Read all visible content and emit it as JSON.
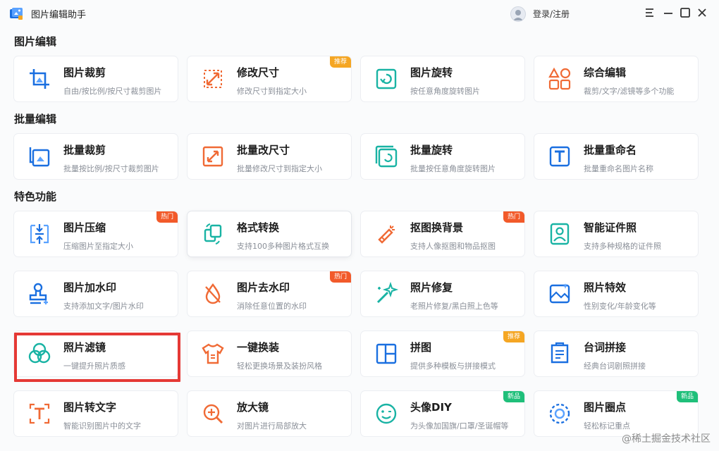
{
  "app": {
    "title": "图片编辑助手",
    "login": "登录/注册"
  },
  "sections": [
    {
      "title": "图片编辑",
      "cards": [
        {
          "title": "图片裁剪",
          "desc": "自由/按比例/按尺寸裁剪图片",
          "icon": "crop-icon"
        },
        {
          "title": "修改尺寸",
          "desc": "修改尺寸到指定大小",
          "icon": "resize-icon",
          "badge": "推荐"
        },
        {
          "title": "图片旋转",
          "desc": "按任意角度旋转图片",
          "icon": "rotate-icon"
        },
        {
          "title": "综合编辑",
          "desc": "裁剪/文字/滤镜等多个功能",
          "icon": "shapes-icon"
        }
      ]
    },
    {
      "title": "批量编辑",
      "cards": [
        {
          "title": "批量裁剪",
          "desc": "批量按比例/按尺寸裁剪图片",
          "icon": "batch-crop-icon"
        },
        {
          "title": "批量改尺寸",
          "desc": "批量修改尺寸到指定大小",
          "icon": "batch-resize-icon"
        },
        {
          "title": "批量旋转",
          "desc": "批量按任意角度旋转图片",
          "icon": "batch-rotate-icon"
        },
        {
          "title": "批量重命名",
          "desc": "批量重命名图片名称",
          "icon": "rename-icon"
        }
      ]
    },
    {
      "title": "特色功能",
      "cards": [
        {
          "title": "图片压缩",
          "desc": "压缩图片至指定大小",
          "icon": "compress-icon",
          "badge": "热门"
        },
        {
          "title": "格式转换",
          "desc": "支持100多种图片格式互换",
          "icon": "convert-icon"
        },
        {
          "title": "抠图换背景",
          "desc": "支持人像抠图和物品抠图",
          "icon": "cutout-icon",
          "badge": "热门"
        },
        {
          "title": "智能证件照",
          "desc": "支持多种规格的证件照",
          "icon": "id-photo-icon"
        },
        {
          "title": "图片加水印",
          "desc": "支持添加文字/图片水印",
          "icon": "stamp-icon"
        },
        {
          "title": "图片去水印",
          "desc": "消除任意位置的水印",
          "icon": "remove-watermark-icon",
          "badge": "热门"
        },
        {
          "title": "照片修复",
          "desc": "老照片修复/黑白照上色等",
          "icon": "magic-wand-icon"
        },
        {
          "title": "照片特效",
          "desc": "性别变化/年龄变化等",
          "icon": "effect-icon"
        },
        {
          "title": "照片滤镜",
          "desc": "一键提升照片质感",
          "icon": "filter-icon"
        },
        {
          "title": "一键换装",
          "desc": "轻松更换场景及装扮风格",
          "icon": "tshirt-icon"
        },
        {
          "title": "拼图",
          "desc": "提供多种模板与拼接模式",
          "icon": "collage-icon",
          "badge": "推荐"
        },
        {
          "title": "台词拼接",
          "desc": "经典台词剧照拼接",
          "icon": "caption-icon"
        },
        {
          "title": "图片转文字",
          "desc": "智能识别图片中的文字",
          "icon": "ocr-icon"
        },
        {
          "title": "放大镜",
          "desc": "对图片进行局部放大",
          "icon": "magnifier-icon"
        },
        {
          "title": "头像DIY",
          "desc": "为头像加国旗/口罩/圣诞帽等",
          "icon": "avatar-diy-icon",
          "badge": "新品"
        },
        {
          "title": "图片圈点",
          "desc": "轻松标记重点",
          "icon": "circle-mark-icon",
          "badge": "新品"
        }
      ]
    }
  ],
  "watermark": "@稀土掘金技术社区",
  "colors": {
    "blue": "#1a6fe0",
    "orange": "#f06a35",
    "teal": "#19b3a4"
  }
}
